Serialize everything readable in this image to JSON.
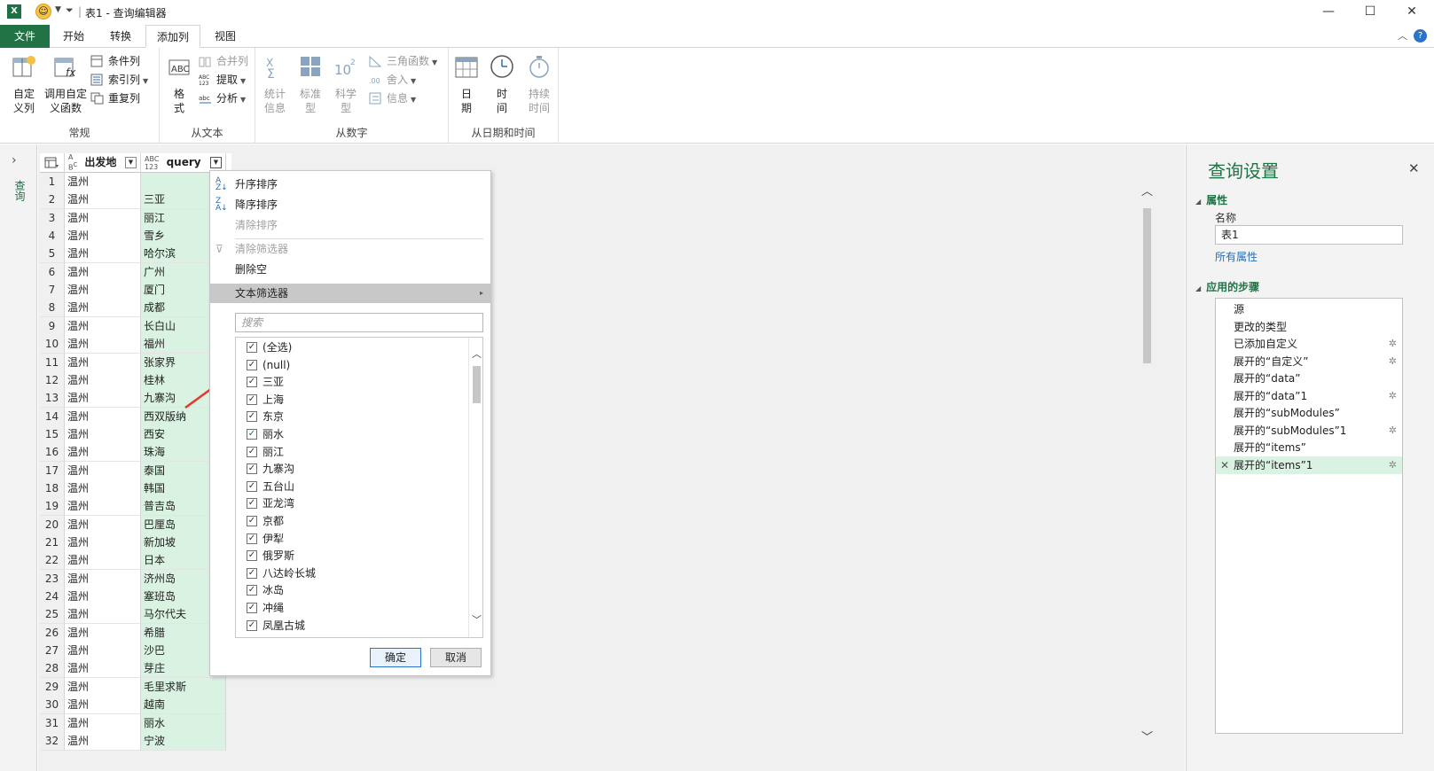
{
  "window": {
    "title": "表1 - 查询编辑器",
    "minimize": "—",
    "maximize": "☐",
    "close": "✕"
  },
  "tabs": [
    "文件",
    "开始",
    "转换",
    "添加列",
    "视图"
  ],
  "ribbon": {
    "general": {
      "label": "常规",
      "custom_col": "自定\n义列",
      "invoke_fn": "调用自定\n义函数",
      "conditional": "条件列",
      "index": "索引列",
      "duplicate": "重复列"
    },
    "from_text": {
      "label": "从文本",
      "format": "格\n式",
      "merge": "合并列",
      "extract": "提取",
      "parse": "分析"
    },
    "from_number": {
      "label": "从数字",
      "stats": "统计\n信息",
      "standard": "标准\n型",
      "scientific": "科学\n型",
      "trig": "三角函数",
      "round": "舍入",
      "info": "信息"
    },
    "from_datetime": {
      "label": "从日期和时间",
      "date": "日\n期",
      "time": "时\n间",
      "duration": "持续\n时间"
    }
  },
  "left_pane": {
    "label": "查询"
  },
  "grid": {
    "col1": "出发地",
    "col2": "query",
    "rows": [
      [
        "1",
        "温州",
        ""
      ],
      [
        "2",
        "温州",
        "三亚"
      ],
      [
        "3",
        "温州",
        "丽江"
      ],
      [
        "4",
        "温州",
        "雪乡"
      ],
      [
        "5",
        "温州",
        "哈尔滨"
      ],
      [
        "6",
        "温州",
        "广州"
      ],
      [
        "7",
        "温州",
        "厦门"
      ],
      [
        "8",
        "温州",
        "成都"
      ],
      [
        "9",
        "温州",
        "长白山"
      ],
      [
        "10",
        "温州",
        "福州"
      ],
      [
        "11",
        "温州",
        "张家界"
      ],
      [
        "12",
        "温州",
        "桂林"
      ],
      [
        "13",
        "温州",
        "九寨沟"
      ],
      [
        "14",
        "温州",
        "西双版纳"
      ],
      [
        "15",
        "温州",
        "西安"
      ],
      [
        "16",
        "温州",
        "珠海"
      ],
      [
        "17",
        "温州",
        "泰国"
      ],
      [
        "18",
        "温州",
        "韩国"
      ],
      [
        "19",
        "温州",
        "普吉岛"
      ],
      [
        "20",
        "温州",
        "巴厘岛"
      ],
      [
        "21",
        "温州",
        "新加坡"
      ],
      [
        "22",
        "温州",
        "日本"
      ],
      [
        "23",
        "温州",
        "济州岛"
      ],
      [
        "24",
        "温州",
        "塞班岛"
      ],
      [
        "25",
        "温州",
        "马尔代夫"
      ],
      [
        "26",
        "温州",
        "希腊"
      ],
      [
        "27",
        "温州",
        "沙巴"
      ],
      [
        "28",
        "温州",
        "芽庄"
      ],
      [
        "29",
        "温州",
        "毛里求斯"
      ],
      [
        "30",
        "温州",
        "越南"
      ],
      [
        "31",
        "温州",
        "丽水"
      ],
      [
        "32",
        "温州",
        "宁波"
      ]
    ]
  },
  "filter": {
    "sort_asc": "升序排序",
    "sort_desc": "降序排序",
    "clear_sort": "清除排序",
    "clear_filter": "清除筛选器",
    "remove_empty": "删除空",
    "text_filter": "文本筛选器",
    "search_placeholder": "搜索",
    "items": [
      "(全选)",
      "(null)",
      "三亚",
      "上海",
      "东京",
      "丽水",
      "丽江",
      "九寨沟",
      "五台山",
      "亚龙湾",
      "京都",
      "伊犁",
      "俄罗斯",
      "八达岭长城",
      "冰岛",
      "冲绳",
      "凤凰古城"
    ],
    "ok": "确定",
    "cancel": "取消"
  },
  "settings": {
    "title": "查询设置",
    "properties": "属性",
    "name_label": "名称",
    "name_value": "表1",
    "all_props": "所有属性",
    "applied_steps": "应用的步骤",
    "steps": [
      {
        "label": "源",
        "gear": false
      },
      {
        "label": "更改的类型",
        "gear": false
      },
      {
        "label": "已添加自定义",
        "gear": true
      },
      {
        "label": "展开的“自定义”",
        "gear": true
      },
      {
        "label": "展开的“data”",
        "gear": false
      },
      {
        "label": "展开的“data”1",
        "gear": true
      },
      {
        "label": "展开的“subModules”",
        "gear": false
      },
      {
        "label": "展开的“subModules”1",
        "gear": true
      },
      {
        "label": "展开的“items”",
        "gear": false
      },
      {
        "label": "展开的“items”1",
        "gear": true,
        "selected": true
      }
    ]
  },
  "colors": {
    "accent": "#217346",
    "highlight": "#d9f2e1",
    "arrow": "#e8372c"
  }
}
